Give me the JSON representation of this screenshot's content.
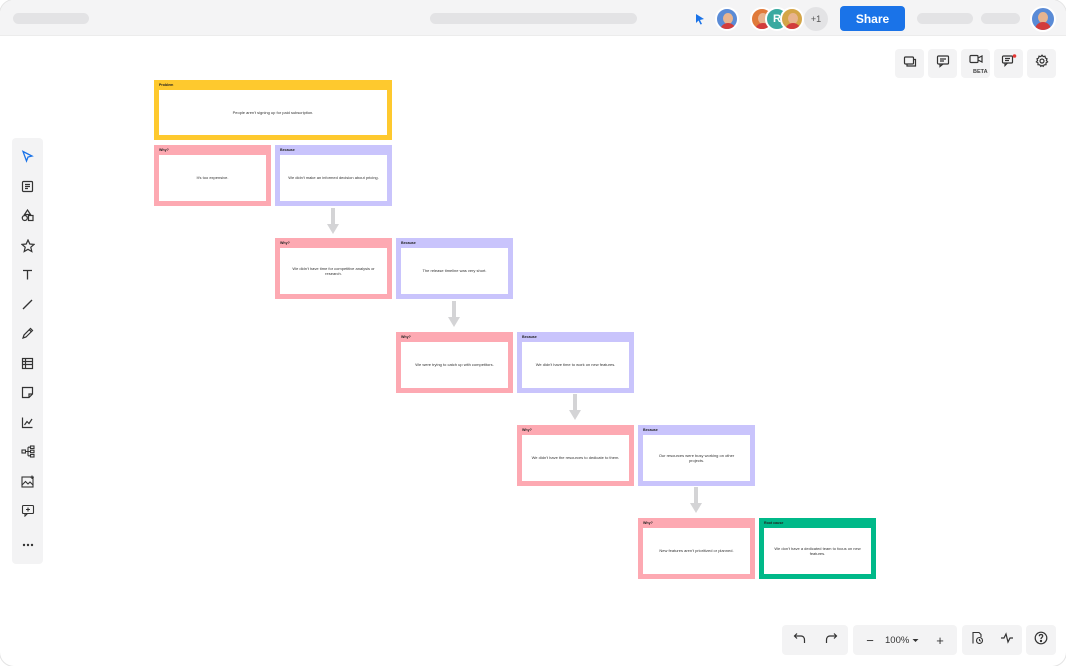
{
  "toolbar": {
    "share_label": "Share",
    "extra_collaborators": "+1",
    "collaborator_initial": "R",
    "beta_label": "BETA"
  },
  "zoom": {
    "level": "100%",
    "minus": "−",
    "plus": "+"
  },
  "colors": {
    "problem": "#fec92e",
    "why": "#fda9b2",
    "because": "#c9c4fc",
    "root_cause": "#00b989",
    "share": "#1a73e8"
  },
  "cards": {
    "problem": {
      "title": "Problem",
      "text": "People aren't signing up for paid subscription."
    },
    "why1": {
      "title": "Why?",
      "text": "It's too expensive."
    },
    "because1": {
      "title": "Because",
      "text": "We didn't make an informed decision about pricing."
    },
    "why2": {
      "title": "Why?",
      "text": "We didn't have time for competitive analysis or research."
    },
    "because2": {
      "title": "Because",
      "text": "The release timeline was very short."
    },
    "why3": {
      "title": "Why?",
      "text": "We were trying to catch up with competitors."
    },
    "because3": {
      "title": "Because",
      "text": "We didn't have time to work on new features."
    },
    "why4": {
      "title": "Why?",
      "text": "We didn't have the resources to dedicate to them."
    },
    "because4": {
      "title": "Because",
      "text": "Our resources were busy working on other projects."
    },
    "why5": {
      "title": "Why?",
      "text": "New features aren't prioritized or planned."
    },
    "root": {
      "title": "Root cause",
      "text": "We don't have a dedicated team to focus on new features."
    }
  },
  "icons": {
    "left_toolbar": [
      "cursor-icon",
      "template-icon",
      "shapes-icon",
      "star-icon",
      "text-icon",
      "line-icon",
      "pen-icon",
      "table-icon",
      "sticky-note-icon",
      "chart-icon",
      "mind-map-icon",
      "image-icon",
      "embed-icon",
      "more-icon"
    ],
    "top_right": [
      "pages-icon",
      "comment-icon",
      "video-icon",
      "chat-icon",
      "settings-icon"
    ],
    "bottom": [
      "undo-icon",
      "redo-icon",
      "history-icon",
      "activity-icon",
      "help-icon"
    ]
  }
}
